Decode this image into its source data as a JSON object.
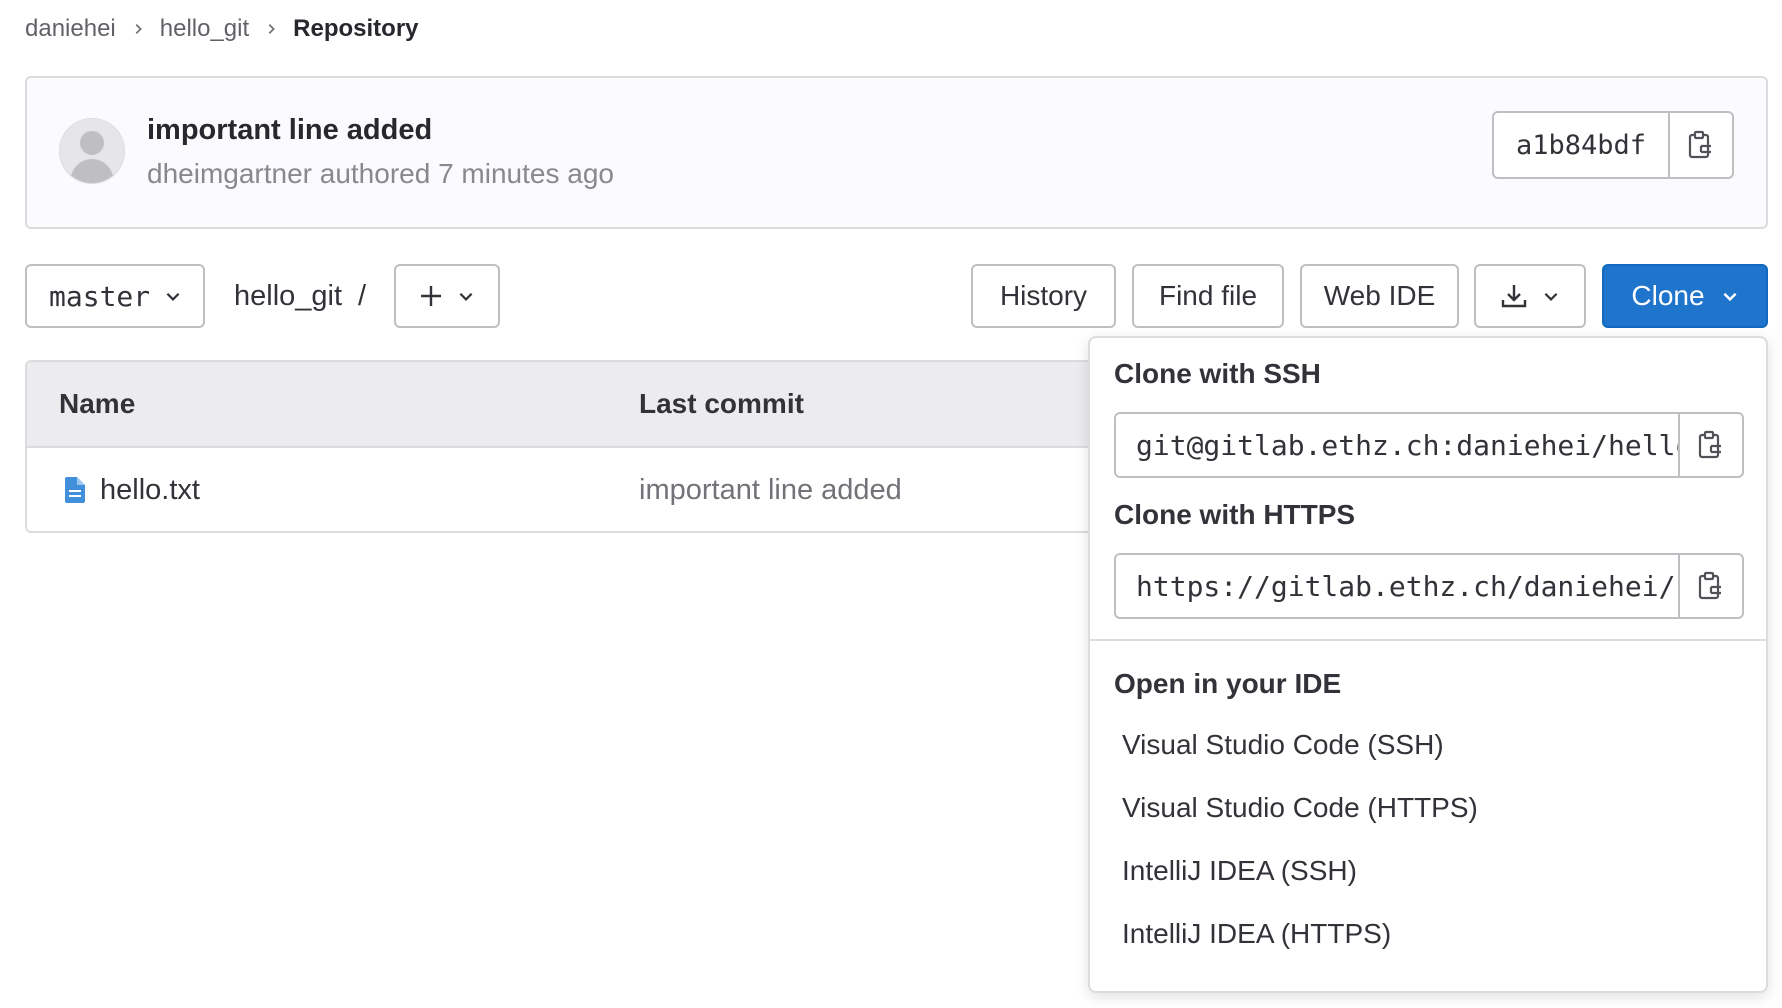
{
  "breadcrumb": {
    "items": [
      "daniehei",
      "hello_git"
    ],
    "current": "Repository"
  },
  "commit": {
    "title": "important line added",
    "meta": "dheimgartner authored 7 minutes ago",
    "sha": "a1b84bdf"
  },
  "toolbar": {
    "branch": "master",
    "path": "hello_git",
    "path_separator": "/",
    "history_label": "History",
    "find_file_label": "Find file",
    "web_ide_label": "Web IDE",
    "clone_label": "Clone"
  },
  "table": {
    "headers": {
      "name": "Name",
      "last_commit": "Last commit"
    },
    "rows": [
      {
        "name": "hello.txt",
        "last_commit": "important line added"
      }
    ]
  },
  "clone_dropdown": {
    "ssh_header": "Clone with SSH",
    "ssh_url": "git@gitlab.ethz.ch:daniehei/hello_git.git",
    "https_header": "Clone with HTTPS",
    "https_url": "https://gitlab.ethz.ch/daniehei/hello_git.git",
    "ide_header": "Open in your IDE",
    "ide_items": [
      "Visual Studio Code (SSH)",
      "Visual Studio Code (HTTPS)",
      "IntelliJ IDEA (SSH)",
      "IntelliJ IDEA (HTTPS)"
    ]
  },
  "colors": {
    "accent": "#1f75cb",
    "file_icon": "#428fdc",
    "border": "#dcdcde"
  },
  "icons": {
    "breadcrumb_separator": "chevron-right-icon",
    "copy": "copy-to-clipboard-icon",
    "dropdown": "chevron-down-icon",
    "add": "plus-icon",
    "download": "download-icon",
    "file": "file-text-icon",
    "avatar": "default-avatar"
  }
}
